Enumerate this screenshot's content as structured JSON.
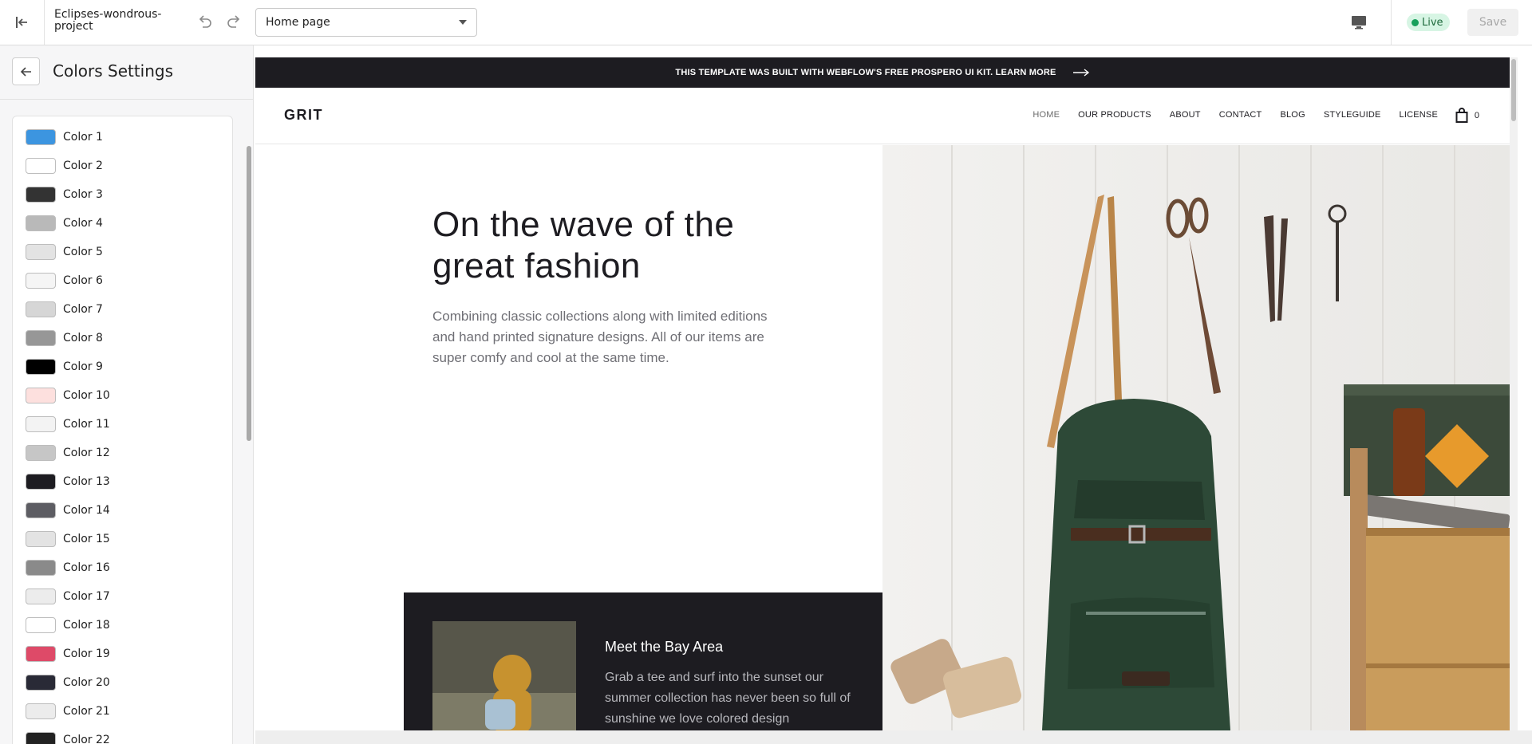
{
  "topbar": {
    "project_name": "Eclipses-wondrous-project",
    "page_select": "Home page",
    "live_label": "Live",
    "save_label": "Save",
    "icons": [
      "exit-icon",
      "undo-icon",
      "redo-icon",
      "desktop-icon"
    ]
  },
  "sidebar": {
    "title": "Colors Settings",
    "colors": [
      {
        "label": "Color 1",
        "hex": "#3c95e0"
      },
      {
        "label": "Color 2",
        "hex": "#ffffff"
      },
      {
        "label": "Color 3",
        "hex": "#333333"
      },
      {
        "label": "Color 4",
        "hex": "#b9b9b9"
      },
      {
        "label": "Color 5",
        "hex": "#e3e3e3"
      },
      {
        "label": "Color 6",
        "hex": "#f5f5f5"
      },
      {
        "label": "Color 7",
        "hex": "#d6d6d6"
      },
      {
        "label": "Color 8",
        "hex": "#979797"
      },
      {
        "label": "Color 9",
        "hex": "#000000"
      },
      {
        "label": "Color 10",
        "hex": "#fde0de"
      },
      {
        "label": "Color 11",
        "hex": "#f3f3f3"
      },
      {
        "label": "Color 12",
        "hex": "#c6c6c6"
      },
      {
        "label": "Color 13",
        "hex": "#1d1c21"
      },
      {
        "label": "Color 14",
        "hex": "#5d5d63"
      },
      {
        "label": "Color 15",
        "hex": "#e3e3e3"
      },
      {
        "label": "Color 16",
        "hex": "#8a8a8a"
      },
      {
        "label": "Color 17",
        "hex": "#ececec"
      },
      {
        "label": "Color 18",
        "hex": "#ffffff"
      },
      {
        "label": "Color 19",
        "hex": "#de4a68"
      },
      {
        "label": "Color 20",
        "hex": "#292a36"
      },
      {
        "label": "Color 21",
        "hex": "#ececec"
      },
      {
        "label": "Color 22",
        "hex": "#222222"
      }
    ]
  },
  "preview": {
    "announcement": "THIS TEMPLATE WAS BUILT WITH WEBFLOW'S FREE PROSPERO UI KIT. LEARN MORE",
    "logo": "GRIT",
    "nav": [
      "HOME",
      "OUR PRODUCTS",
      "ABOUT",
      "CONTACT",
      "BLOG",
      "STYLEGUIDE",
      "LICENSE"
    ],
    "cart_count": "0",
    "hero_title": "On the wave of the great fashion",
    "hero_text": "Combining classic collections along with limited editions and hand printed signature designs. All of our items are super comfy and cool at the same time.",
    "card_title": "Meet the Bay Area",
    "card_text": "Grab a tee and surf into the sunset our summer collection has never been so full of sunshine we love colored design"
  },
  "colors": {
    "announcement_bg": "#1d1c21",
    "live_bg": "#d7f5e4",
    "live_dot": "#17a05b"
  }
}
